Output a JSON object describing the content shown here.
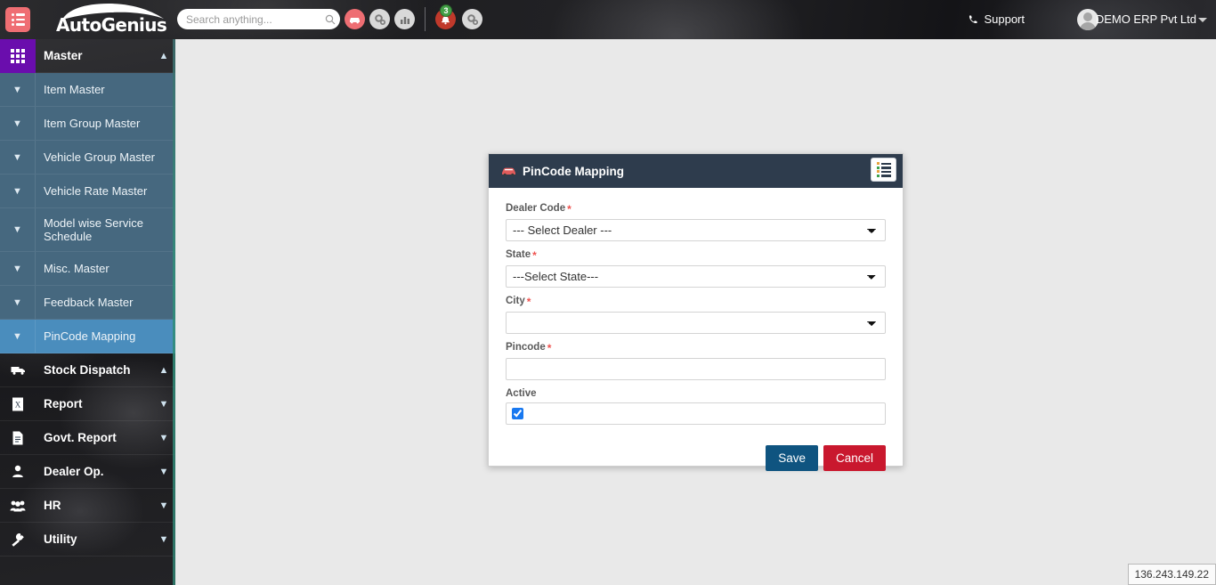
{
  "header": {
    "menu_toggle_icon": "hamburger-list-icon",
    "logo_text": "AutoGenius",
    "search": {
      "placeholder": "Search anything...",
      "value": "",
      "icon": "search-icon"
    },
    "icons": [
      {
        "name": "car-icon",
        "style": "red"
      },
      {
        "name": "gears-icon",
        "style": "gray"
      },
      {
        "name": "bar-chart-icon",
        "style": "gray"
      },
      {
        "name": "bell-icon",
        "style": "red"
      },
      {
        "name": "cogs-icon",
        "style": "gray"
      }
    ],
    "notification_count": "3",
    "support_label": "Support",
    "support_icon": "phone-icon",
    "username": "DEMO ERP Pvt Ltd",
    "avatar_icon": "user-avatar-icon",
    "caret_icon": "caret-down-icon"
  },
  "sidebar": {
    "groups": [
      {
        "label": "Master",
        "icon": "grid-icon",
        "chevron": "chevron-up-icon",
        "expanded": true,
        "items": [
          {
            "label": "Item Master",
            "chevron": "chevron-down-icon",
            "active": false
          },
          {
            "label": "Item Group Master",
            "chevron": "chevron-down-icon",
            "active": false
          },
          {
            "label": "Vehicle Group Master",
            "chevron": "chevron-down-icon",
            "active": false
          },
          {
            "label": "Vehicle Rate Master",
            "chevron": "chevron-down-icon",
            "active": false
          },
          {
            "label": "Model wise Service Schedule",
            "chevron": "chevron-down-icon",
            "active": false
          },
          {
            "label": "Misc. Master",
            "chevron": "chevron-down-icon",
            "active": false
          },
          {
            "label": "Feedback Master",
            "chevron": "chevron-down-icon",
            "active": false
          },
          {
            "label": "PinCode Mapping",
            "chevron": "chevron-down-icon",
            "active": true
          }
        ]
      },
      {
        "label": "Stock Dispatch",
        "icon": "truck-icon",
        "chevron": "chevron-up-icon",
        "expanded": false,
        "items": []
      },
      {
        "label": "Report",
        "icon": "excel-file-icon",
        "chevron": "chevron-down-icon",
        "expanded": false,
        "items": []
      },
      {
        "label": "Govt. Report",
        "icon": "document-icon",
        "chevron": "chevron-down-icon",
        "expanded": false,
        "items": []
      },
      {
        "label": "Dealer Op.",
        "icon": "user-icon",
        "chevron": "chevron-down-icon",
        "expanded": false,
        "items": []
      },
      {
        "label": "HR",
        "icon": "users-group-icon",
        "chevron": "chevron-down-icon",
        "expanded": false,
        "items": []
      },
      {
        "label": "Utility",
        "icon": "wrench-icon",
        "chevron": "chevron-down-icon",
        "expanded": false,
        "items": []
      }
    ]
  },
  "modal": {
    "title": "PinCode Mapping",
    "title_icon": "car-icon",
    "panel_button_icon": "list-icon",
    "fields": [
      {
        "label": "Dealer Code",
        "required": true,
        "type": "select",
        "value": "--- Select Dealer ---"
      },
      {
        "label": "State",
        "required": true,
        "type": "select",
        "value": "---Select State---"
      },
      {
        "label": "City",
        "required": true,
        "type": "select",
        "value": ""
      },
      {
        "label": "Pincode",
        "required": true,
        "type": "text",
        "value": "",
        "placeholder": ""
      },
      {
        "label": "Active",
        "required": false,
        "type": "checkbox",
        "checked": true
      }
    ],
    "save_label": "Save",
    "cancel_label": "Cancel"
  },
  "footer": {
    "ip_address": "136.243.149.22"
  },
  "colors": {
    "accent_purple": "#6a0dad",
    "sidebar_sub": "#46687f",
    "sidebar_active": "#4a8dbd",
    "modal_header": "#2e3c4d",
    "save_blue": "#0f5480",
    "cancel_red": "#c9182e",
    "required_red": "#ef5350",
    "badge_green": "#43a047",
    "page_bg": "#e9e9e9"
  }
}
